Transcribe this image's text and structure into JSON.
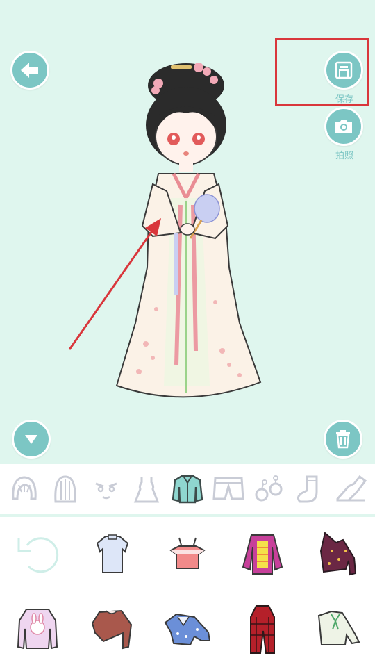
{
  "toolbar": {
    "back_icon": "arrow-left-icon",
    "save_label": "保存",
    "camera_label": "拍照",
    "collapse_icon": "triangle-down-icon",
    "trash_icon": "trash-icon"
  },
  "colors": {
    "stage_bg": "#dff6ee",
    "button": "#7cc6c4",
    "highlight": "#d9363b",
    "active_category": "#8fd6cf"
  },
  "categories": [
    {
      "name": "hair-front",
      "icon": "hair-bangs-icon",
      "active": false
    },
    {
      "name": "hair-back",
      "icon": "hair-long-icon",
      "active": false
    },
    {
      "name": "face",
      "icon": "face-expression-icon",
      "active": false
    },
    {
      "name": "dress",
      "icon": "dress-icon",
      "active": false
    },
    {
      "name": "top",
      "icon": "jacket-icon",
      "active": true
    },
    {
      "name": "bottom",
      "icon": "shorts-icon",
      "active": false
    },
    {
      "name": "accessory",
      "icon": "earrings-icon",
      "active": false
    },
    {
      "name": "socks",
      "icon": "sock-icon",
      "active": false
    },
    {
      "name": "shoes",
      "icon": "shoe-icon",
      "active": false
    }
  ],
  "items": [
    {
      "icon": "undo-icon"
    },
    {
      "icon": "blue-shirt-icon"
    },
    {
      "icon": "pink-camisole-icon"
    },
    {
      "icon": "striped-jacket-icon"
    },
    {
      "icon": "star-jacket-icon"
    },
    {
      "icon": "bunny-sweater-icon"
    },
    {
      "icon": "brown-sweater-icon"
    },
    {
      "icon": "blue-floral-top-icon"
    },
    {
      "icon": "red-plaid-coat-icon"
    },
    {
      "icon": "bow-blouse-icon"
    }
  ]
}
